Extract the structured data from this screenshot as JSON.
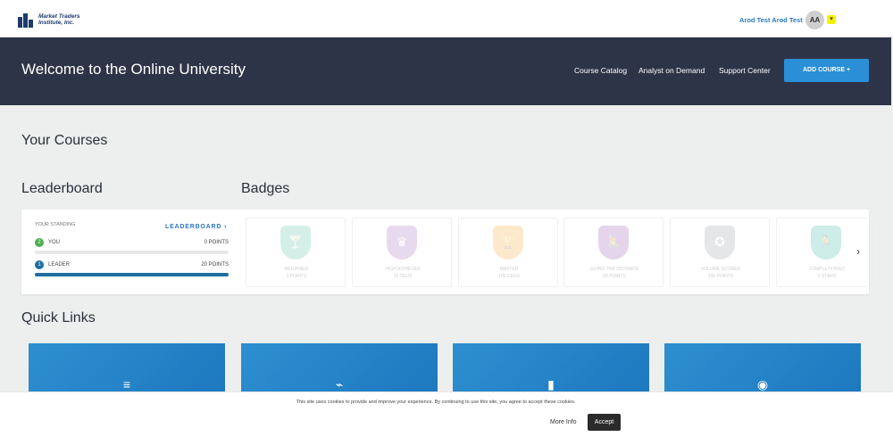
{
  "header": {
    "logo_line1": "Market Traders",
    "logo_line2": "Institute, Inc.",
    "user_name": "Arod Test Arod Test",
    "avatar_initials": "AA",
    "chevron_icon": "chevron-down-icon"
  },
  "hero": {
    "title": "Welcome to the Online University",
    "nav": [
      "Course Catalog",
      "Analyst on Demand",
      "Support Center"
    ],
    "add_course": "ADD COURSE +"
  },
  "sections": {
    "your_courses": "Your Courses",
    "leaderboard": "Leaderboard",
    "badges": "Badges",
    "quick_links": "Quick Links"
  },
  "leaderboard": {
    "standing_label": "YOUR STANDING",
    "link": "LEADERBOARD ›",
    "you": {
      "rank": "2",
      "label": "YOU",
      "points": "0 POINTS",
      "progress": 0,
      "rank_color": "#4caf50"
    },
    "leader": {
      "rank": "1",
      "label": "LEADER",
      "points": "20 POINTS",
      "progress": 1,
      "rank_color": "#1e6f9e"
    }
  },
  "badges": [
    {
      "name": "BEGINNER",
      "points": "2 POINTS",
      "color": "#3bb89a",
      "icon": "cocktail-glass-icon"
    },
    {
      "name": "HIGH ACHIEVER",
      "points": "15 CEUS",
      "color": "#9b59b6",
      "icon": "crown-icon"
    },
    {
      "name": "MASTER",
      "points": "100 CEUS",
      "color": "#f39c12",
      "icon": "trophy-icon"
    },
    {
      "name": "GOING THE DISTANCE",
      "points": "50 POINTS",
      "color": "#8e44ad",
      "icon": "cyclist-icon"
    },
    {
      "name": "VOLUME SCORER",
      "points": "100 POINTS",
      "color": "#8a8f99",
      "icon": "medal-icon"
    },
    {
      "name": "COMPLETIONIST",
      "points": "5 STARS",
      "color": "#27ae9a",
      "icon": "runner-icon"
    }
  ],
  "quick_links": [
    {
      "icon": "document-icon",
      "glyph": "≡"
    },
    {
      "icon": "paperclip-icon",
      "glyph": "⌁"
    },
    {
      "icon": "bar-chart-icon",
      "glyph": "▮"
    },
    {
      "icon": "lifebuoy-icon",
      "glyph": "◉"
    }
  ],
  "cookie": {
    "text": "This site uses cookies to provide and improve your experience. By continuing to use this site, you agree to accept these cookies.",
    "more_info": "More Info",
    "accept": "Accept"
  }
}
